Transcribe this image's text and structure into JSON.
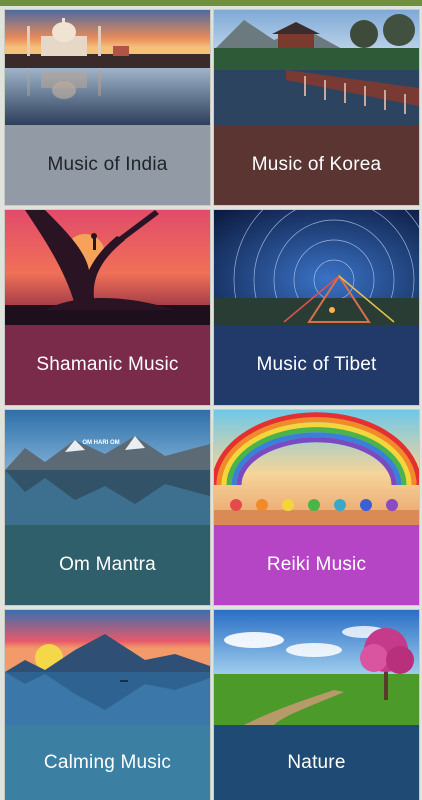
{
  "categories": [
    {
      "label": "Music of India",
      "label_bg": "#919aa5",
      "label_color": "#1f2327",
      "image": "taj-mahal-sunset-image"
    },
    {
      "label": "Music of Korea",
      "label_bg": "#5a3532",
      "label_color": "#ffffff",
      "image": "korean-pavilion-bridge-image"
    },
    {
      "label": "Shamanic Music",
      "label_bg": "#7a2b4a",
      "label_color": "#ffffff",
      "image": "shaman-tree-silhouette-image"
    },
    {
      "label": "Music of Tibet",
      "label_bg": "#223a6a",
      "label_color": "#ffffff",
      "image": "star-trails-prayer-flags-image"
    },
    {
      "label": "Om Mantra",
      "label_bg": "#2f5f6a",
      "label_color": "#ffffff",
      "image": "mountain-lake-reflection-image",
      "image_caption": "OM HARI OM"
    },
    {
      "label": "Reiki Music",
      "label_bg": "#b545c5",
      "label_color": "#ffffff",
      "image": "rainbow-lotus-image"
    },
    {
      "label": "Calming Music",
      "label_bg": "#3b7fa3",
      "label_color": "#ffffff",
      "image": "sunset-mountain-lake-image"
    },
    {
      "label": "Nature",
      "label_bg": "#1f4a73",
      "label_color": "#ffffff",
      "image": "blossom-tree-meadow-image"
    }
  ]
}
